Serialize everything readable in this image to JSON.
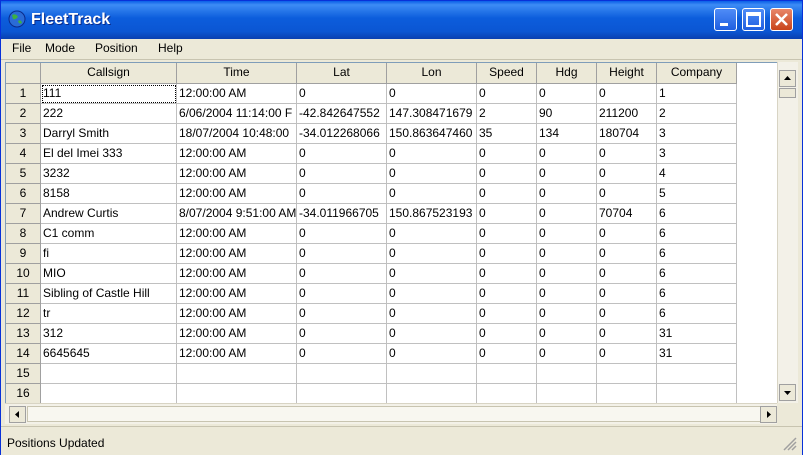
{
  "window": {
    "title": "FleetTrack"
  },
  "menu": [
    "File",
    "Mode",
    "Position",
    "Help"
  ],
  "grid": {
    "columns": [
      "Callsign",
      "Time",
      "Lat",
      "Lon",
      "Speed",
      "Hdg",
      "Height",
      "Company"
    ],
    "rows": [
      [
        "111",
        "12:00:00 AM",
        "0",
        "0",
        "0",
        "0",
        "0",
        "1"
      ],
      [
        "222",
        "6/06/2004 11:14:00 F",
        "-42.842647552",
        "147.308471679",
        "2",
        "90",
        "211200",
        "2"
      ],
      [
        "Darryl Smith",
        "18/07/2004 10:48:00",
        "-34.012268066",
        "150.863647460",
        "35",
        "134",
        "180704",
        "3"
      ],
      [
        "El del Imei 333",
        "12:00:00 AM",
        "0",
        "0",
        "0",
        "0",
        "0",
        "3"
      ],
      [
        "3232",
        "12:00:00 AM",
        "0",
        "0",
        "0",
        "0",
        "0",
        "4"
      ],
      [
        "8158",
        "12:00:00 AM",
        "0",
        "0",
        "0",
        "0",
        "0",
        "5"
      ],
      [
        "Andrew Curtis",
        "8/07/2004 9:51:00 AM",
        "-34.011966705",
        "150.867523193",
        "0",
        "0",
        "70704",
        "6"
      ],
      [
        "C1 comm",
        "12:00:00 AM",
        "0",
        "0",
        "0",
        "0",
        "0",
        "6"
      ],
      [
        "fi",
        "12:00:00 AM",
        "0",
        "0",
        "0",
        "0",
        "0",
        "6"
      ],
      [
        "MIO",
        "12:00:00 AM",
        "0",
        "0",
        "0",
        "0",
        "0",
        "6"
      ],
      [
        "Sibling of Castle Hill",
        "12:00:00 AM",
        "0",
        "0",
        "0",
        "0",
        "0",
        "6"
      ],
      [
        "tr",
        "12:00:00 AM",
        "0",
        "0",
        "0",
        "0",
        "0",
        "6"
      ],
      [
        "312",
        "12:00:00 AM",
        "0",
        "0",
        "0",
        "0",
        "0",
        "31"
      ],
      [
        "6645645",
        "12:00:00 AM",
        "0",
        "0",
        "0",
        "0",
        "0",
        "31"
      ],
      [
        "",
        "",
        "",
        "",
        "",
        "",
        "",
        ""
      ],
      [
        "",
        "",
        "",
        "",
        "",
        "",
        "",
        ""
      ]
    ]
  },
  "status": {
    "text": "Positions Updated"
  }
}
